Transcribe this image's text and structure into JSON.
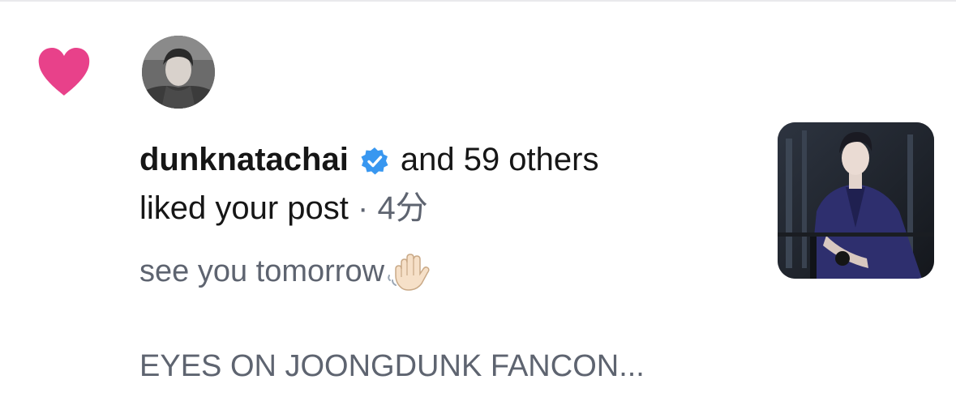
{
  "notification": {
    "type_icon": "heart-icon",
    "type_color": "#e8418a",
    "avatar_icon": "avatar-photo",
    "username": "dunknatachai",
    "verified_icon": "verified-badge-icon",
    "verified_color": "#3897f0",
    "others_text": "and 59 others",
    "action_text": "liked your post",
    "separator": " · ",
    "time": "4分",
    "caption": "see you tomorrow",
    "caption_emoji_icon": "waving-hand-icon",
    "headline": "EYES ON JOONGDUNK FANCON...",
    "thumbnail_icon": "post-thumbnail-photo"
  }
}
